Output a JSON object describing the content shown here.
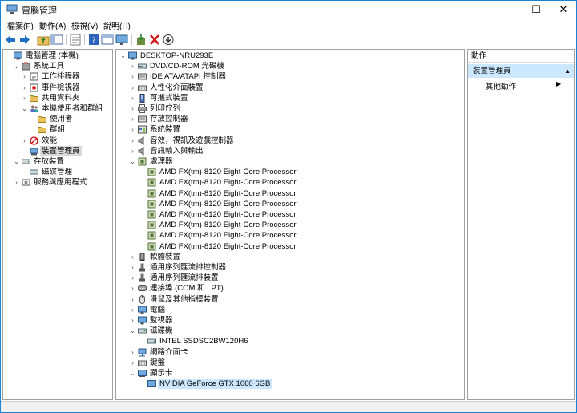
{
  "window": {
    "title": "電腦管理",
    "controls": {
      "minimize": "—",
      "maximize": "☐",
      "close": "✕"
    }
  },
  "menu": [
    "檔案(F)",
    "動作(A)",
    "檢視(V)",
    "說明(H)"
  ],
  "left_tree": [
    {
      "label": "電腦管理 (本機)",
      "exp": "",
      "icon": "computer-management-icon",
      "level": 0
    },
    {
      "label": "系統工具",
      "exp": "⌄",
      "icon": "tools-icon",
      "level": 1
    },
    {
      "label": "工作排程器",
      "exp": "›",
      "icon": "task-scheduler-icon",
      "level": 2
    },
    {
      "label": "事件檢視器",
      "exp": "›",
      "icon": "event-viewer-icon",
      "level": 2
    },
    {
      "label": "共用資料夾",
      "exp": "›",
      "icon": "shared-folders-icon",
      "level": 2
    },
    {
      "label": "本機使用者和群組",
      "exp": "⌄",
      "icon": "users-groups-icon",
      "level": 2
    },
    {
      "label": "使用者",
      "exp": "",
      "icon": "folder-icon",
      "level": 3
    },
    {
      "label": "群組",
      "exp": "",
      "icon": "folder-icon",
      "level": 3
    },
    {
      "label": "效能",
      "exp": "›",
      "icon": "performance-icon",
      "level": 2
    },
    {
      "label": "裝置管理員",
      "exp": "",
      "icon": "device-manager-icon",
      "level": 2,
      "selected": true
    },
    {
      "label": "存放裝置",
      "exp": "⌄",
      "icon": "storage-icon",
      "level": 1
    },
    {
      "label": "磁碟管理",
      "exp": "",
      "icon": "disk-management-icon",
      "level": 2
    },
    {
      "label": "服務與應用程式",
      "exp": "›",
      "icon": "services-icon",
      "level": 1
    }
  ],
  "device_tree": [
    {
      "label": "DESKTOP-NRU293E",
      "exp": "⌄",
      "icon": "computer-icon",
      "level": 0
    },
    {
      "label": "DVD/CD-ROM 光碟機",
      "exp": "›",
      "icon": "dvd-icon",
      "level": 1
    },
    {
      "label": "IDE ATA/ATAPI 控制器",
      "exp": "›",
      "icon": "ide-controller-icon",
      "level": 1
    },
    {
      "label": "人性化介面裝置",
      "exp": "›",
      "icon": "hid-icon",
      "level": 1
    },
    {
      "label": "可攜式裝置",
      "exp": "›",
      "icon": "portable-device-icon",
      "level": 1
    },
    {
      "label": "列印佇列",
      "exp": "›",
      "icon": "printer-icon",
      "level": 1
    },
    {
      "label": "存放控制器",
      "exp": "›",
      "icon": "storage-controller-icon",
      "level": 1
    },
    {
      "label": "系統裝置",
      "exp": "›",
      "icon": "system-device-icon",
      "level": 1
    },
    {
      "label": "音效，視訊及遊戲控制器",
      "exp": "›",
      "icon": "sound-icon",
      "level": 1
    },
    {
      "label": "音訊輸入與輸出",
      "exp": "›",
      "icon": "audio-io-icon",
      "level": 1
    },
    {
      "label": "處理器",
      "exp": "⌄",
      "icon": "processor-icon",
      "level": 1
    },
    {
      "label": "AMD FX(tm)-8120 Eight-Core Processor",
      "exp": "",
      "icon": "processor-icon",
      "level": 2
    },
    {
      "label": "AMD FX(tm)-8120 Eight-Core Processor",
      "exp": "",
      "icon": "processor-icon",
      "level": 2
    },
    {
      "label": "AMD FX(tm)-8120 Eight-Core Processor",
      "exp": "",
      "icon": "processor-icon",
      "level": 2
    },
    {
      "label": "AMD FX(tm)-8120 Eight-Core Processor",
      "exp": "",
      "icon": "processor-icon",
      "level": 2
    },
    {
      "label": "AMD FX(tm)-8120 Eight-Core Processor",
      "exp": "",
      "icon": "processor-icon",
      "level": 2
    },
    {
      "label": "AMD FX(tm)-8120 Eight-Core Processor",
      "exp": "",
      "icon": "processor-icon",
      "level": 2
    },
    {
      "label": "AMD FX(tm)-8120 Eight-Core Processor",
      "exp": "",
      "icon": "processor-icon",
      "level": 2
    },
    {
      "label": "AMD FX(tm)-8120 Eight-Core Processor",
      "exp": "",
      "icon": "processor-icon",
      "level": 2
    },
    {
      "label": "軟體裝置",
      "exp": "›",
      "icon": "software-device-icon",
      "level": 1
    },
    {
      "label": "通用序列匯流排控制器",
      "exp": "›",
      "icon": "usb-icon",
      "level": 1
    },
    {
      "label": "通用序列匯流排裝置",
      "exp": "›",
      "icon": "usb-icon",
      "level": 1
    },
    {
      "label": "連接埠 (COM 和 LPT)",
      "exp": "›",
      "icon": "port-icon",
      "level": 1
    },
    {
      "label": "滑鼠及其他指標裝置",
      "exp": "›",
      "icon": "mouse-icon",
      "level": 1
    },
    {
      "label": "電腦",
      "exp": "›",
      "icon": "monitor-icon",
      "level": 1
    },
    {
      "label": "監視器",
      "exp": "›",
      "icon": "monitor-icon",
      "level": 1
    },
    {
      "label": "磁碟機",
      "exp": "⌄",
      "icon": "disk-drive-icon",
      "level": 1
    },
    {
      "label": "INTEL SSDSC2BW120H6",
      "exp": "",
      "icon": "disk-drive-icon",
      "level": 2
    },
    {
      "label": "網路介面卡",
      "exp": "›",
      "icon": "network-adapter-icon",
      "level": 1
    },
    {
      "label": "鍵盤",
      "exp": "›",
      "icon": "keyboard-icon",
      "level": 1
    },
    {
      "label": "顯示卡",
      "exp": "⌄",
      "icon": "display-adapter-icon",
      "level": 1
    },
    {
      "label": "NVIDIA GeForce GTX 1060 6GB",
      "exp": "",
      "icon": "display-adapter-icon",
      "level": 2,
      "selected": true
    }
  ],
  "actions": {
    "header": "動作",
    "selected": "裝置管理員",
    "item": "其他動作"
  },
  "colors": {
    "accent": "#1883d7",
    "selection": "#cce8ff",
    "border": "#a0a0a0"
  }
}
